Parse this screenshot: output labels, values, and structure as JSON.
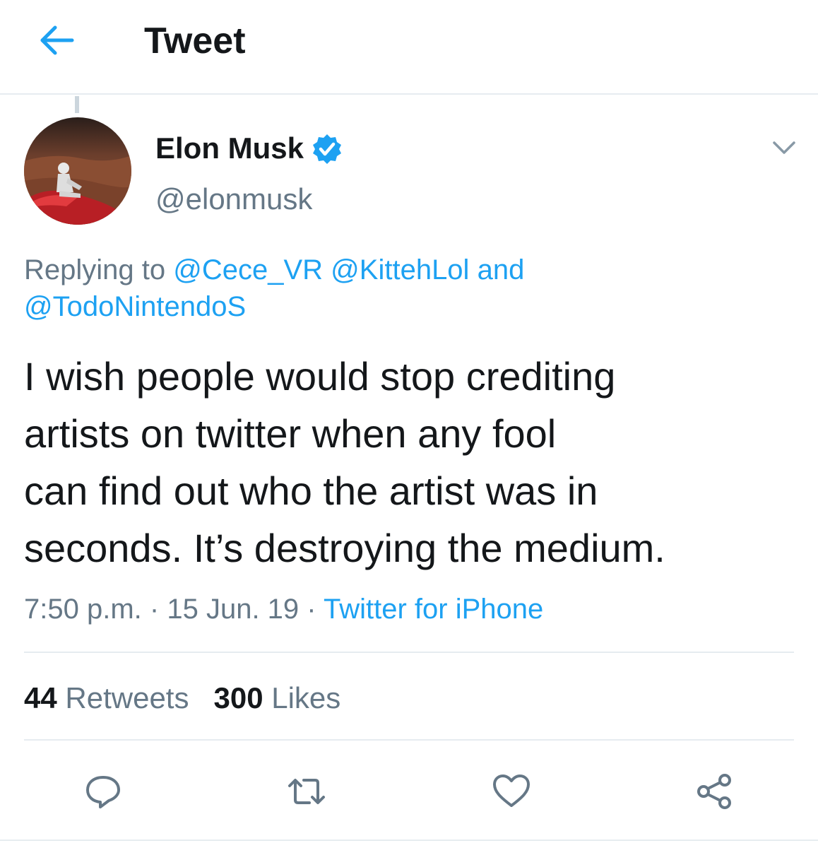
{
  "header": {
    "title": "Tweet",
    "back_icon": "arrow-left-icon"
  },
  "author": {
    "name": "Elon Musk",
    "handle": "@elonmusk",
    "verified_icon": "verified-badge-icon"
  },
  "reply": {
    "prefix": "Replying to",
    "mentions": [
      "@Cece_VR",
      "@KittehLol",
      "@TodoNintendoS"
    ],
    "conjunction": "and"
  },
  "tweet": {
    "lines": [
      "I wish people would stop crediting",
      "artists on twitter when any fool",
      "can find out who the artist was in",
      "seconds. It’s destroying the medium."
    ]
  },
  "meta": {
    "time": "7:50 p.m.",
    "date": "15 Jun. 19",
    "separator": "·",
    "source": "Twitter for iPhone"
  },
  "stats": {
    "retweets_count": "44",
    "retweets_label": "Retweets",
    "likes_count": "300",
    "likes_label": "Likes"
  },
  "actions": [
    "reply-icon",
    "retweet-icon",
    "like-icon",
    "share-icon"
  ],
  "colors": {
    "accent": "#1da1f2",
    "text": "#14171a",
    "secondary": "#657786",
    "divider": "#e6ecf0"
  }
}
